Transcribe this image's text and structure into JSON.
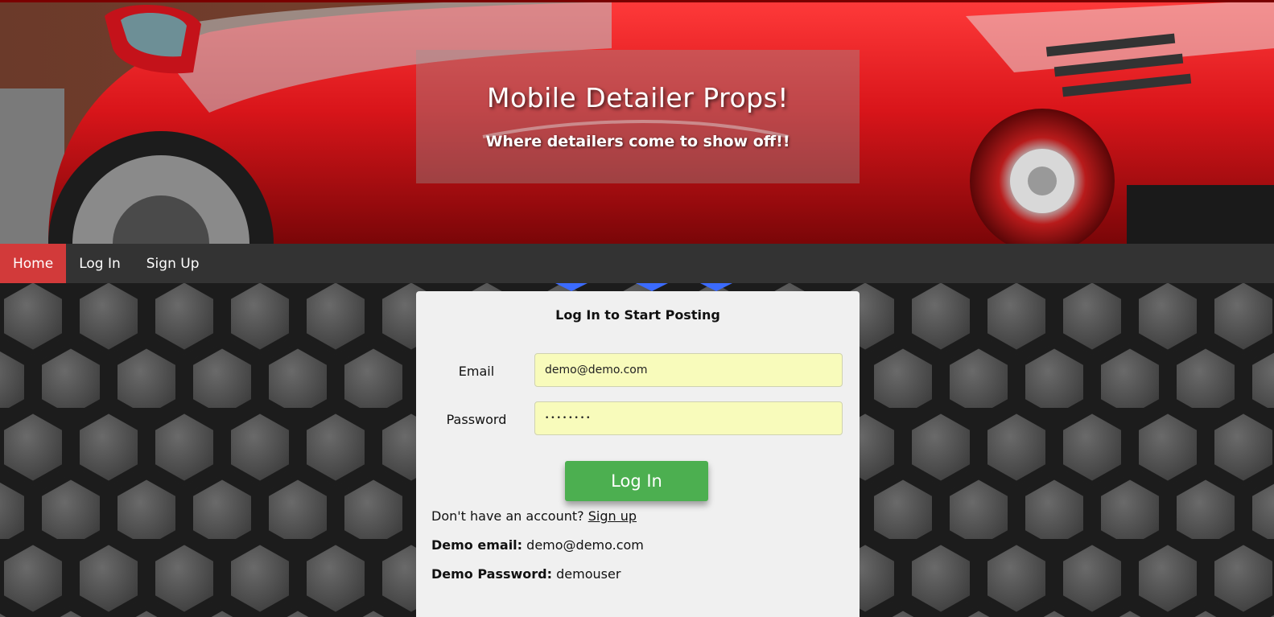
{
  "hero": {
    "title": "Mobile Detailer Props!",
    "subtitle": "Where detailers come to show off!!"
  },
  "nav": {
    "items": [
      {
        "label": "Home",
        "active": true
      },
      {
        "label": "Log In",
        "active": false
      },
      {
        "label": "Sign Up",
        "active": false
      }
    ]
  },
  "login": {
    "title": "Log In to Start Posting",
    "email_label": "Email",
    "email_value": "demo@demo.com",
    "password_label": "Password",
    "password_value": "••••••••",
    "button_label": "Log In",
    "no_account_text": "Don't have an account?",
    "signup_link": "Sign up",
    "demo_email_label": "Demo email:",
    "demo_email_value": "demo@demo.com",
    "demo_password_label": "Demo Password:",
    "demo_password_value": "demouser"
  },
  "colors": {
    "nav_active": "#d23a3a",
    "nav_bg": "#333333",
    "button": "#4caf50",
    "input_bg": "#f8fbbb",
    "card_bg": "#f0f0f0"
  }
}
